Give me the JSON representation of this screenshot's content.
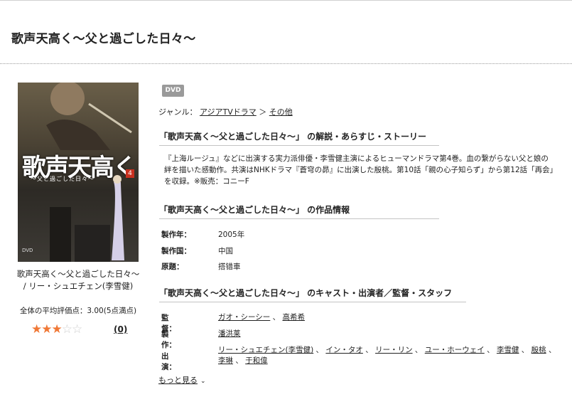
{
  "page": {
    "title": "歌声天高く～父と過ごした日々～"
  },
  "item": {
    "cover": {
      "title": "歌声天高く",
      "subtitle": "〜父と過ごした日々〜",
      "volume": "4",
      "format_mark": "DVD"
    },
    "caption_line1": "歌声天高く～父と過ごした日々～",
    "caption_line2": "/ リー・シュエチェン(李雪健)",
    "avg_rating_text": "全体の平均評価点：3.00(5点満点)",
    "rating": 3,
    "rating_max": 5,
    "review_count": "(0)"
  },
  "badge": "DVD",
  "genre": {
    "label": "ジャンル：",
    "crumb1": "アジアTVドラマ",
    "separator": "＞",
    "crumb2": "その他"
  },
  "sections": {
    "synopsis_heading": "「歌声天高く～父と過ごした日々～」 の解説・あらすじ・ストーリー",
    "synopsis_text": "『上海ルージュ』などに出演する実力派俳優・李雪健主演によるヒューマンドラマ第4巻。血の繋がらない父と娘の絆を描いた感動作。共演はNHKドラマ『蒼穹の昴』に出演した殷桃。第10話「親の心子知らず」から第12話「再会」を収録。※販売：コニーF",
    "info_heading": "「歌声天高く～父と過ごした日々～」 の作品情報",
    "info": [
      {
        "key": "製作年：",
        "value": "2005年"
      },
      {
        "key": "製作国：",
        "value": "中国"
      },
      {
        "key": "原題：",
        "value": "搭错車"
      }
    ],
    "cast_heading": "「歌声天高く～父と過ごした日々～」 のキャスト・出演者／監督・スタッフ",
    "director_key": "監督：",
    "directors": [
      "ガオ・シーシー",
      "高希希"
    ],
    "producer_key": "製作：",
    "producers": [
      "潘洪莱"
    ],
    "cast_key": "出演：",
    "cast": [
      "リー・シュエチェン(李雪健)",
      "イン・タオ",
      "リー・リン",
      "ユー・ホーウェイ",
      "李雪健",
      "殷桃",
      "李琳",
      "于和偉"
    ],
    "more_label": "もっと見る"
  }
}
